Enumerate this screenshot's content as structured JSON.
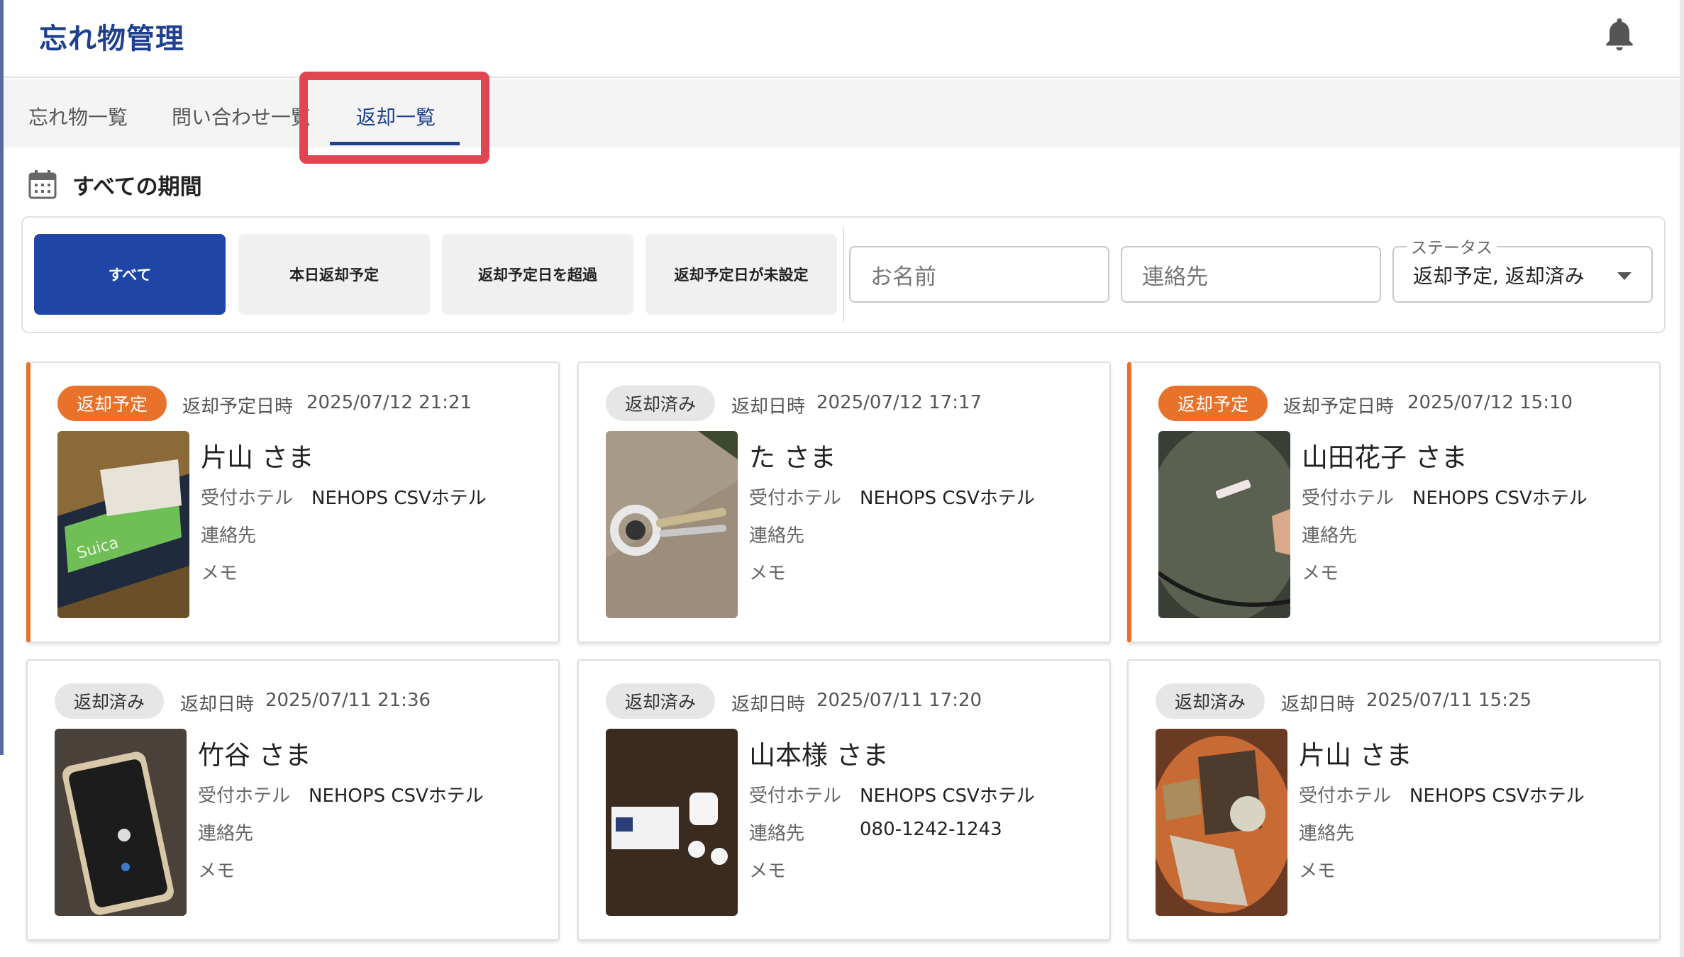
{
  "header": {
    "title": "忘れ物管理",
    "bell_icon": "bell-icon"
  },
  "tabs": [
    {
      "label": "忘れ物一覧"
    },
    {
      "label": "問い合わせ一覧"
    },
    {
      "label": "返却一覧"
    }
  ],
  "period": {
    "label": "すべての期間",
    "icon": "calendar-icon"
  },
  "filters": {
    "buttons": [
      "すべて",
      "本日返却予定",
      "返却予定日を超過",
      "返却予定日が未設定"
    ],
    "name_placeholder": "お名前",
    "contact_placeholder": "連絡先",
    "status_label": "ステータス",
    "status_value": "返却予定, 返却済み"
  },
  "colors": {
    "accent": "#1f45a6",
    "scheduled": "#e8722a",
    "highlight": "#e04652"
  },
  "field_labels": {
    "hotel": "受付ホテル",
    "contact": "連絡先",
    "memo": "メモ"
  },
  "cards": [
    {
      "status": "返却予定",
      "date_label": "返却予定日時",
      "date": "2025/07/12 21:21",
      "name": "片山 さま",
      "hotel": "NEHOPS CSVホテル",
      "contact": "",
      "memo": ""
    },
    {
      "status": "返却済み",
      "date_label": "返却日時",
      "date": "2025/07/12 17:17",
      "name": "た さま",
      "hotel": "NEHOPS CSVホテル",
      "contact": "",
      "memo": ""
    },
    {
      "status": "返却予定",
      "date_label": "返却予定日時",
      "date": "2025/07/12 15:10",
      "name": "山田花子 さま",
      "hotel": "NEHOPS CSVホテル",
      "contact": "",
      "memo": ""
    },
    {
      "status": "返却済み",
      "date_label": "返却日時",
      "date": "2025/07/11 21:36",
      "name": "竹谷 さま",
      "hotel": "NEHOPS CSVホテル",
      "contact": "",
      "memo": ""
    },
    {
      "status": "返却済み",
      "date_label": "返却日時",
      "date": "2025/07/11 17:20",
      "name": "山本様 さま",
      "hotel": "NEHOPS CSVホテル",
      "contact": "080-1242-1243",
      "memo": ""
    },
    {
      "status": "返却済み",
      "date_label": "返却日時",
      "date": "2025/07/11 15:25",
      "name": "片山 さま",
      "hotel": "NEHOPS CSVホテル",
      "contact": "",
      "memo": ""
    }
  ]
}
